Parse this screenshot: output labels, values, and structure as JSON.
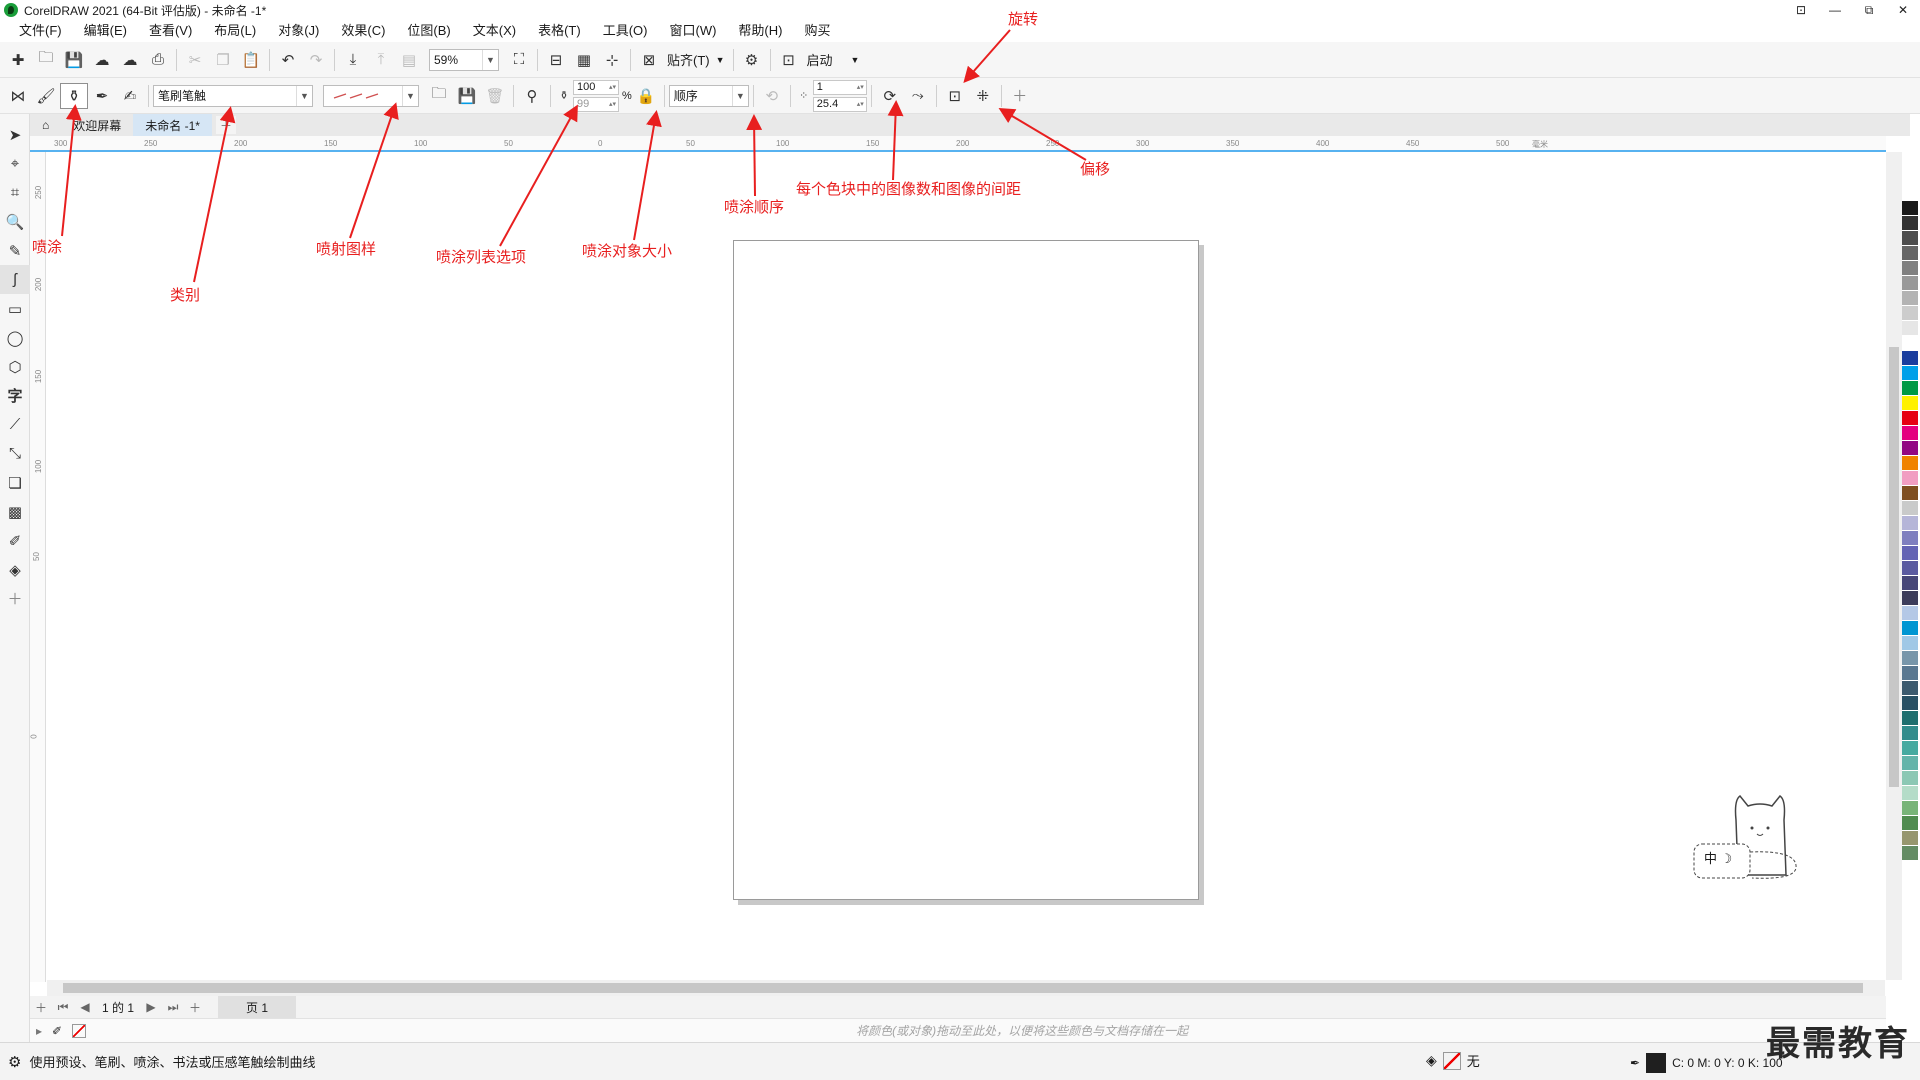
{
  "window": {
    "title": "CorelDRAW 2021 (64-Bit 评估版) - 未命名 -1*",
    "controls": [
      "⊡",
      "—",
      "⧉",
      "✕"
    ]
  },
  "menu": [
    "文件(F)",
    "编辑(E)",
    "查看(V)",
    "布局(L)",
    "对象(J)",
    "效果(C)",
    "位图(B)",
    "文本(X)",
    "表格(T)",
    "工具(O)",
    "窗口(W)",
    "帮助(H)",
    "购买"
  ],
  "toolbar1": {
    "zoom": "59%",
    "snap_label": "贴齐(T)",
    "launch_label": "启动"
  },
  "toolbar2": {
    "category_value": "笔刷笔触",
    "size_top": "100",
    "size_bottom": "99",
    "size_unit": "%",
    "order_value": "顺序",
    "dabs_top": "1",
    "dabs_bottom": "25.4"
  },
  "tabs": {
    "welcome": "欢迎屏幕",
    "document": "未命名 -1*"
  },
  "ruler": {
    "h_ticks": [
      "300",
      "250",
      "200",
      "150",
      "100",
      "50",
      "0",
      "50",
      "100",
      "150",
      "200",
      "250",
      "300",
      "350",
      "400",
      "450",
      "500"
    ],
    "h_unit": "毫米",
    "v_ticks": [
      "250",
      "200",
      "150",
      "100",
      "50",
      "0"
    ]
  },
  "pagenav": {
    "position": "1 的 1",
    "page_tab": "页 1"
  },
  "docpalette": {
    "hint": "将颜色(或对象)拖动至此处，以便将这些颜色与文档存储在一起"
  },
  "status": {
    "message": "使用预设、笔刷、喷涂、书法或压感笔触绘制曲线",
    "fill_none": "无",
    "cmyk": "C: 0 M: 0 Y: 0 K: 100"
  },
  "watermark": "最需教育",
  "mascot_label": "中 ☽",
  "annotations": {
    "rotate": "旋转",
    "offset": "偏移",
    "dabs_spacing": "每个色块中的图像数和图像的间距",
    "spray_order": "喷涂顺序",
    "spray": "喷涂",
    "category": "类别",
    "spray_pattern": "喷射图样",
    "spray_list": "喷涂列表选项",
    "spray_size": "喷涂对象大小"
  },
  "colors": {
    "accent": "#57b2f0",
    "annotation": "#e81f1f"
  },
  "palette": [
    "#ffffff",
    "#1a1a1a",
    "#333333",
    "#4d4d4d",
    "#666666",
    "#808080",
    "#999999",
    "#b3b3b3",
    "#cccccc",
    "#e6e6e6",
    "#ffffff",
    "#1a3d9e",
    "#00a0e9",
    "#009944",
    "#fff100",
    "#e60012",
    "#e4007f",
    "#920783",
    "#f08300",
    "#f19ec2",
    "#7f4f21",
    "#c9caca",
    "#b5b5d8",
    "#7f7fbf",
    "#6464b4",
    "#5a5aa0",
    "#464678",
    "#3c3c5a",
    "#b4c8e6",
    "#0096d2",
    "#a0c8e6",
    "#7896aa",
    "#5a7891",
    "#3c5a6e",
    "#285064",
    "#1e6e6e",
    "#328c8c",
    "#46aaa0",
    "#64b4aa",
    "#8cc8b4",
    "#b4dcc8",
    "#78b478",
    "#508c50",
    "#96966e",
    "#648c64"
  ]
}
